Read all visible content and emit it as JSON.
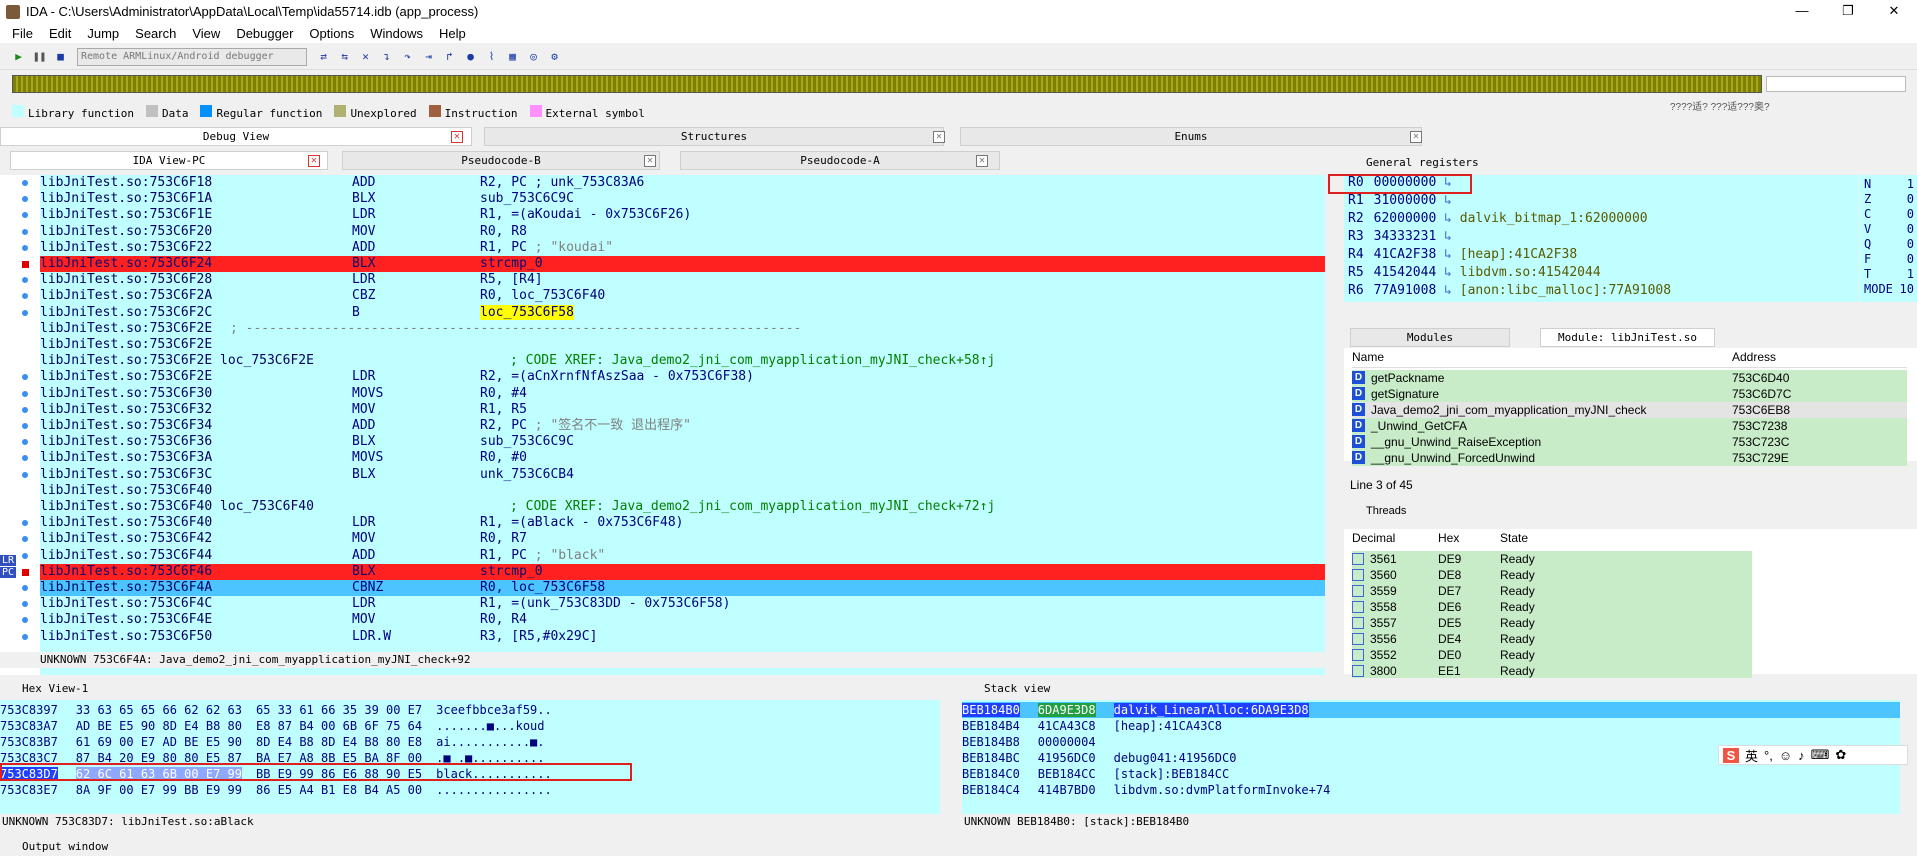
{
  "title": "IDA - C:\\Users\\Administrator\\AppData\\Local\\Temp\\ida55714.idb (app_process)",
  "menu": [
    "File",
    "Edit",
    "Jump",
    "Search",
    "View",
    "Debugger",
    "Options",
    "Windows",
    "Help"
  ],
  "debugger_select": "Remote ARMLinux/Android debugger",
  "nav_hint": "????适?  ???适???奥?",
  "legend": [
    {
      "label": "Library function",
      "color": "#c0ffff"
    },
    {
      "label": "Data",
      "color": "#c0c0c0"
    },
    {
      "label": "Regular function",
      "color": "#0090ff"
    },
    {
      "label": "Unexplored",
      "color": "#b0b070"
    },
    {
      "label": "Instruction",
      "color": "#a06040"
    },
    {
      "label": "External symbol",
      "color": "#ff90ff"
    }
  ],
  "tabs_top": {
    "debug_view": "Debug View",
    "structures": "Structures",
    "enums": "Enums"
  },
  "tabs_code": {
    "ida_view": "IDA View-PC",
    "pseudo_b": "Pseudocode-B",
    "pseudo_a": "Pseudocode-A"
  },
  "code_lines": [
    {
      "addr": "libJniTest.so:753C6F18",
      "mn": "ADD",
      "op": "R2, PC ; unk_753C83A6",
      "cmt": "",
      "kind": "normal",
      "mark": "dot"
    },
    {
      "addr": "libJniTest.so:753C6F1A",
      "mn": "BLX",
      "op": "sub_753C6C9C",
      "cmt": "",
      "kind": "normal",
      "mark": "dot"
    },
    {
      "addr": "libJniTest.so:753C6F1E",
      "mn": "LDR",
      "op": "R1, =(aKoudai - 0x753C6F26)",
      "cmt": "",
      "kind": "normal",
      "mark": "dot"
    },
    {
      "addr": "libJniTest.so:753C6F20",
      "mn": "MOV",
      "op": "R0, R8",
      "cmt": "",
      "kind": "normal",
      "mark": "dot"
    },
    {
      "addr": "libJniTest.so:753C6F22",
      "mn": "ADD",
      "op": "R1, PC",
      "cmt": " ; \"koudai\"",
      "kind": "normal",
      "mark": "dot"
    },
    {
      "addr": "libJniTest.so:753C6F24",
      "mn": "BLX",
      "op": "strcmp_0",
      "cmt": "",
      "kind": "red",
      "mark": "red"
    },
    {
      "addr": "libJniTest.so:753C6F28",
      "mn": "LDR",
      "op": "R5, [R4]",
      "cmt": "",
      "kind": "normal",
      "mark": "dot"
    },
    {
      "addr": "libJniTest.so:753C6F2A",
      "mn": "CBZ",
      "op": "R0, loc_753C6F40",
      "cmt": "",
      "kind": "normal",
      "mark": "dot"
    },
    {
      "addr": "libJniTest.so:753C6F2C",
      "mn": "B",
      "op": "loc_753C6F58",
      "cmt": "",
      "kind": "yellowop",
      "mark": "dot"
    },
    {
      "addr": "libJniTest.so:753C6F2E",
      "mn": "",
      "op": "",
      "cmt": "; -----------------------------------------------------------------------",
      "kind": "sep",
      "mark": ""
    },
    {
      "addr": "libJniTest.so:753C6F2E",
      "mn": "",
      "op": "",
      "cmt": "",
      "kind": "normal",
      "mark": ""
    },
    {
      "addr": "libJniTest.so:753C6F2E loc_753C6F2E",
      "mn": "",
      "op": "",
      "cmt": "; CODE XREF: Java_demo2_jni_com_myapplication_myJNI_check+58↑j",
      "kind": "xref",
      "mark": ""
    },
    {
      "addr": "libJniTest.so:753C6F2E",
      "mn": "LDR",
      "op": "R2, =(aCnXrnfNfAszSaa - 0x753C6F38)",
      "cmt": "",
      "kind": "normal",
      "mark": "dot"
    },
    {
      "addr": "libJniTest.so:753C6F30",
      "mn": "MOVS",
      "op": "R0, #4",
      "cmt": "",
      "kind": "normal",
      "mark": "dot"
    },
    {
      "addr": "libJniTest.so:753C6F32",
      "mn": "MOV",
      "op": "R1, R5",
      "cmt": "",
      "kind": "normal",
      "mark": "dot"
    },
    {
      "addr": "libJniTest.so:753C6F34",
      "mn": "ADD",
      "op": "R2, PC",
      "cmt": " ; \"签名不一致 退出程序\"",
      "kind": "normal",
      "mark": "dot"
    },
    {
      "addr": "libJniTest.so:753C6F36",
      "mn": "BLX",
      "op": "sub_753C6C9C",
      "cmt": "",
      "kind": "normal",
      "mark": "dot"
    },
    {
      "addr": "libJniTest.so:753C6F3A",
      "mn": "MOVS",
      "op": "R0, #0",
      "cmt": "",
      "kind": "normal",
      "mark": "dot"
    },
    {
      "addr": "libJniTest.so:753C6F3C",
      "mn": "BLX",
      "op": "unk_753C6CB4",
      "cmt": "",
      "kind": "normal",
      "mark": "dot"
    },
    {
      "addr": "libJniTest.so:753C6F40",
      "mn": "",
      "op": "",
      "cmt": "",
      "kind": "normal",
      "mark": ""
    },
    {
      "addr": "libJniTest.so:753C6F40 loc_753C6F40",
      "mn": "",
      "op": "",
      "cmt": "; CODE XREF: Java_demo2_jni_com_myapplication_myJNI_check+72↑j",
      "kind": "xref",
      "mark": ""
    },
    {
      "addr": "libJniTest.so:753C6F40",
      "mn": "LDR",
      "op": "R1, =(aBlack - 0x753C6F48)",
      "cmt": "",
      "kind": "normal",
      "mark": "dot"
    },
    {
      "addr": "libJniTest.so:753C6F42",
      "mn": "MOV",
      "op": "R0, R7",
      "cmt": "",
      "kind": "normal",
      "mark": "dot"
    },
    {
      "addr": "libJniTest.so:753C6F44",
      "mn": "ADD",
      "op": "R1, PC",
      "cmt": " ; \"black\"",
      "kind": "normal",
      "mark": "dot"
    },
    {
      "addr": "libJniTest.so:753C6F46",
      "mn": "BLX",
      "op": "strcmp_0",
      "cmt": "",
      "kind": "red",
      "mark": "red"
    },
    {
      "addr": "libJniTest.so:753C6F4A",
      "mn": "CBNZ",
      "op": "R0, loc_753C6F58",
      "cmt": "",
      "kind": "blue",
      "mark": "dot"
    },
    {
      "addr": "libJniTest.so:753C6F4C",
      "mn": "LDR",
      "op": "R1, =(unk_753C83DD - 0x753C6F58)",
      "cmt": "",
      "kind": "normal",
      "mark": "dot"
    },
    {
      "addr": "libJniTest.so:753C6F4E",
      "mn": "MOV",
      "op": "R0, R4",
      "cmt": "",
      "kind": "normal",
      "mark": "dot"
    },
    {
      "addr": "libJniTest.so:753C6F50",
      "mn": "LDR.W",
      "op": "R3, [R5,#0x29C]",
      "cmt": "",
      "kind": "normal",
      "mark": "dot"
    }
  ],
  "code_status": "UNKNOWN 753C6F4A: Java_demo2_jni_com_myapplication_myJNI_check+92",
  "gutter_labels": [
    "LR",
    "PC"
  ],
  "registers_title": "General registers",
  "registers": [
    {
      "name": "R0",
      "val": "00000000",
      "sym": ""
    },
    {
      "name": "R1",
      "val": "31000000",
      "sym": ""
    },
    {
      "name": "R2",
      "val": "62000000",
      "sym": "dalvik_bitmap_1:62000000"
    },
    {
      "name": "R3",
      "val": "34333231",
      "sym": ""
    },
    {
      "name": "R4",
      "val": "41CA2F38",
      "sym": "[heap]:41CA2F38"
    },
    {
      "name": "R5",
      "val": "41542044",
      "sym": "libdvm.so:41542044"
    },
    {
      "name": "R6",
      "val": "77A91008",
      "sym": "[anon:libc_malloc]:77A91008"
    }
  ],
  "flags": [
    {
      "name": "N",
      "val": "1"
    },
    {
      "name": "Z",
      "val": "0"
    },
    {
      "name": "C",
      "val": "0"
    },
    {
      "name": "V",
      "val": "0"
    },
    {
      "name": "Q",
      "val": "0"
    },
    {
      "name": "F",
      "val": "0"
    },
    {
      "name": "T",
      "val": "1"
    },
    {
      "name": "MODE",
      "val": "10"
    }
  ],
  "modules_tab": "Modules",
  "module_tab": "Module: libJniTest.so",
  "module_cols": [
    "Name",
    "Address"
  ],
  "module_rows": [
    {
      "name": "getPackname",
      "addr": "753C6D40"
    },
    {
      "name": "getSignature",
      "addr": "753C6D7C"
    },
    {
      "name": "Java_demo2_jni_com_myapplication_myJNI_check",
      "addr": "753C6EB8"
    },
    {
      "name": "_Unwind_GetCFA",
      "addr": "753C7238"
    },
    {
      "name": "__gnu_Unwind_RaiseException",
      "addr": "753C723C"
    },
    {
      "name": "__gnu_Unwind_ForcedUnwind",
      "addr": "753C729E"
    }
  ],
  "module_status": "Line 3 of 45",
  "threads_title": "Threads",
  "thread_cols": [
    "Decimal",
    "Hex",
    "State"
  ],
  "threads": [
    {
      "dec": "3561",
      "hex": "DE9",
      "state": "Ready"
    },
    {
      "dec": "3560",
      "hex": "DE8",
      "state": "Ready"
    },
    {
      "dec": "3559",
      "hex": "DE7",
      "state": "Ready"
    },
    {
      "dec": "3558",
      "hex": "DE6",
      "state": "Ready"
    },
    {
      "dec": "3557",
      "hex": "DE5",
      "state": "Ready"
    },
    {
      "dec": "3556",
      "hex": "DE4",
      "state": "Ready"
    },
    {
      "dec": "3552",
      "hex": "DE0",
      "state": "Ready"
    },
    {
      "dec": "3800",
      "hex": "EE1",
      "state": "Ready"
    }
  ],
  "hex_title": "Hex View-1",
  "hex_rows": [
    {
      "addr": "753C8397",
      "b1": "33 63 65 65 66 62 62 63",
      "b2": "65 33 61 66 35 39 00 E7",
      "asc": "3ceefbbce3af59.."
    },
    {
      "addr": "753C83A7",
      "b1": "AD BE E5 90 8D E4 B8 80",
      "b2": "E8 87 B4 00 6B 6F 75 64",
      "asc": ".......■...koud"
    },
    {
      "addr": "753C83B7",
      "b1": "61 69 00 E7 AD BE E5 90",
      "b2": "8D E4 B8 8D E4 B8 80 E8",
      "asc": "ai...........■."
    },
    {
      "addr": "753C83C7",
      "b1": "87 B4 20 E9 80 80 E5 87",
      "b2": "BA E7 A8 8B E5 BA 8F 00",
      "asc": ".■ .■.........."
    },
    {
      "addr": "753C83D7",
      "b1": "62 6C 61 63 6B 00 E7 99",
      "b2": "BB E9 99 86 E6 88 90 E5",
      "asc": "black..........."
    },
    {
      "addr": "753C83E7",
      "b1": "8A 9F 00 E7 99 BB E9 99",
      "b2": "86 E5 A4 B1 E8 B4 A5 00",
      "asc": "................"
    }
  ],
  "hex_status": "UNKNOWN 753C83D7: libJniTest.so:aBlack",
  "stack_title": "Stack view",
  "stack_rows": [
    {
      "addr": "BEB184B0",
      "val": "6DA9E3D8",
      "sym": "dalvik_LinearAlloc:6DA9E3D8"
    },
    {
      "addr": "BEB184B4",
      "val": "41CA43C8",
      "sym": "[heap]:41CA43C8"
    },
    {
      "addr": "BEB184B8",
      "val": "00000004",
      "sym": ""
    },
    {
      "addr": "BEB184BC",
      "val": "41956DC0",
      "sym": "debug041:41956DC0"
    },
    {
      "addr": "BEB184C0",
      "val": "BEB184CC",
      "sym": "[stack]:BEB184CC"
    },
    {
      "addr": "BEB184C4",
      "val": "414B7BD0",
      "sym": "libdvm.so:dvmPlatformInvoke+74"
    }
  ],
  "stack_status": "UNKNOWN BEB184B0: [stack]:BEB184B0",
  "output_title": "Output window",
  "ime_label": "英"
}
